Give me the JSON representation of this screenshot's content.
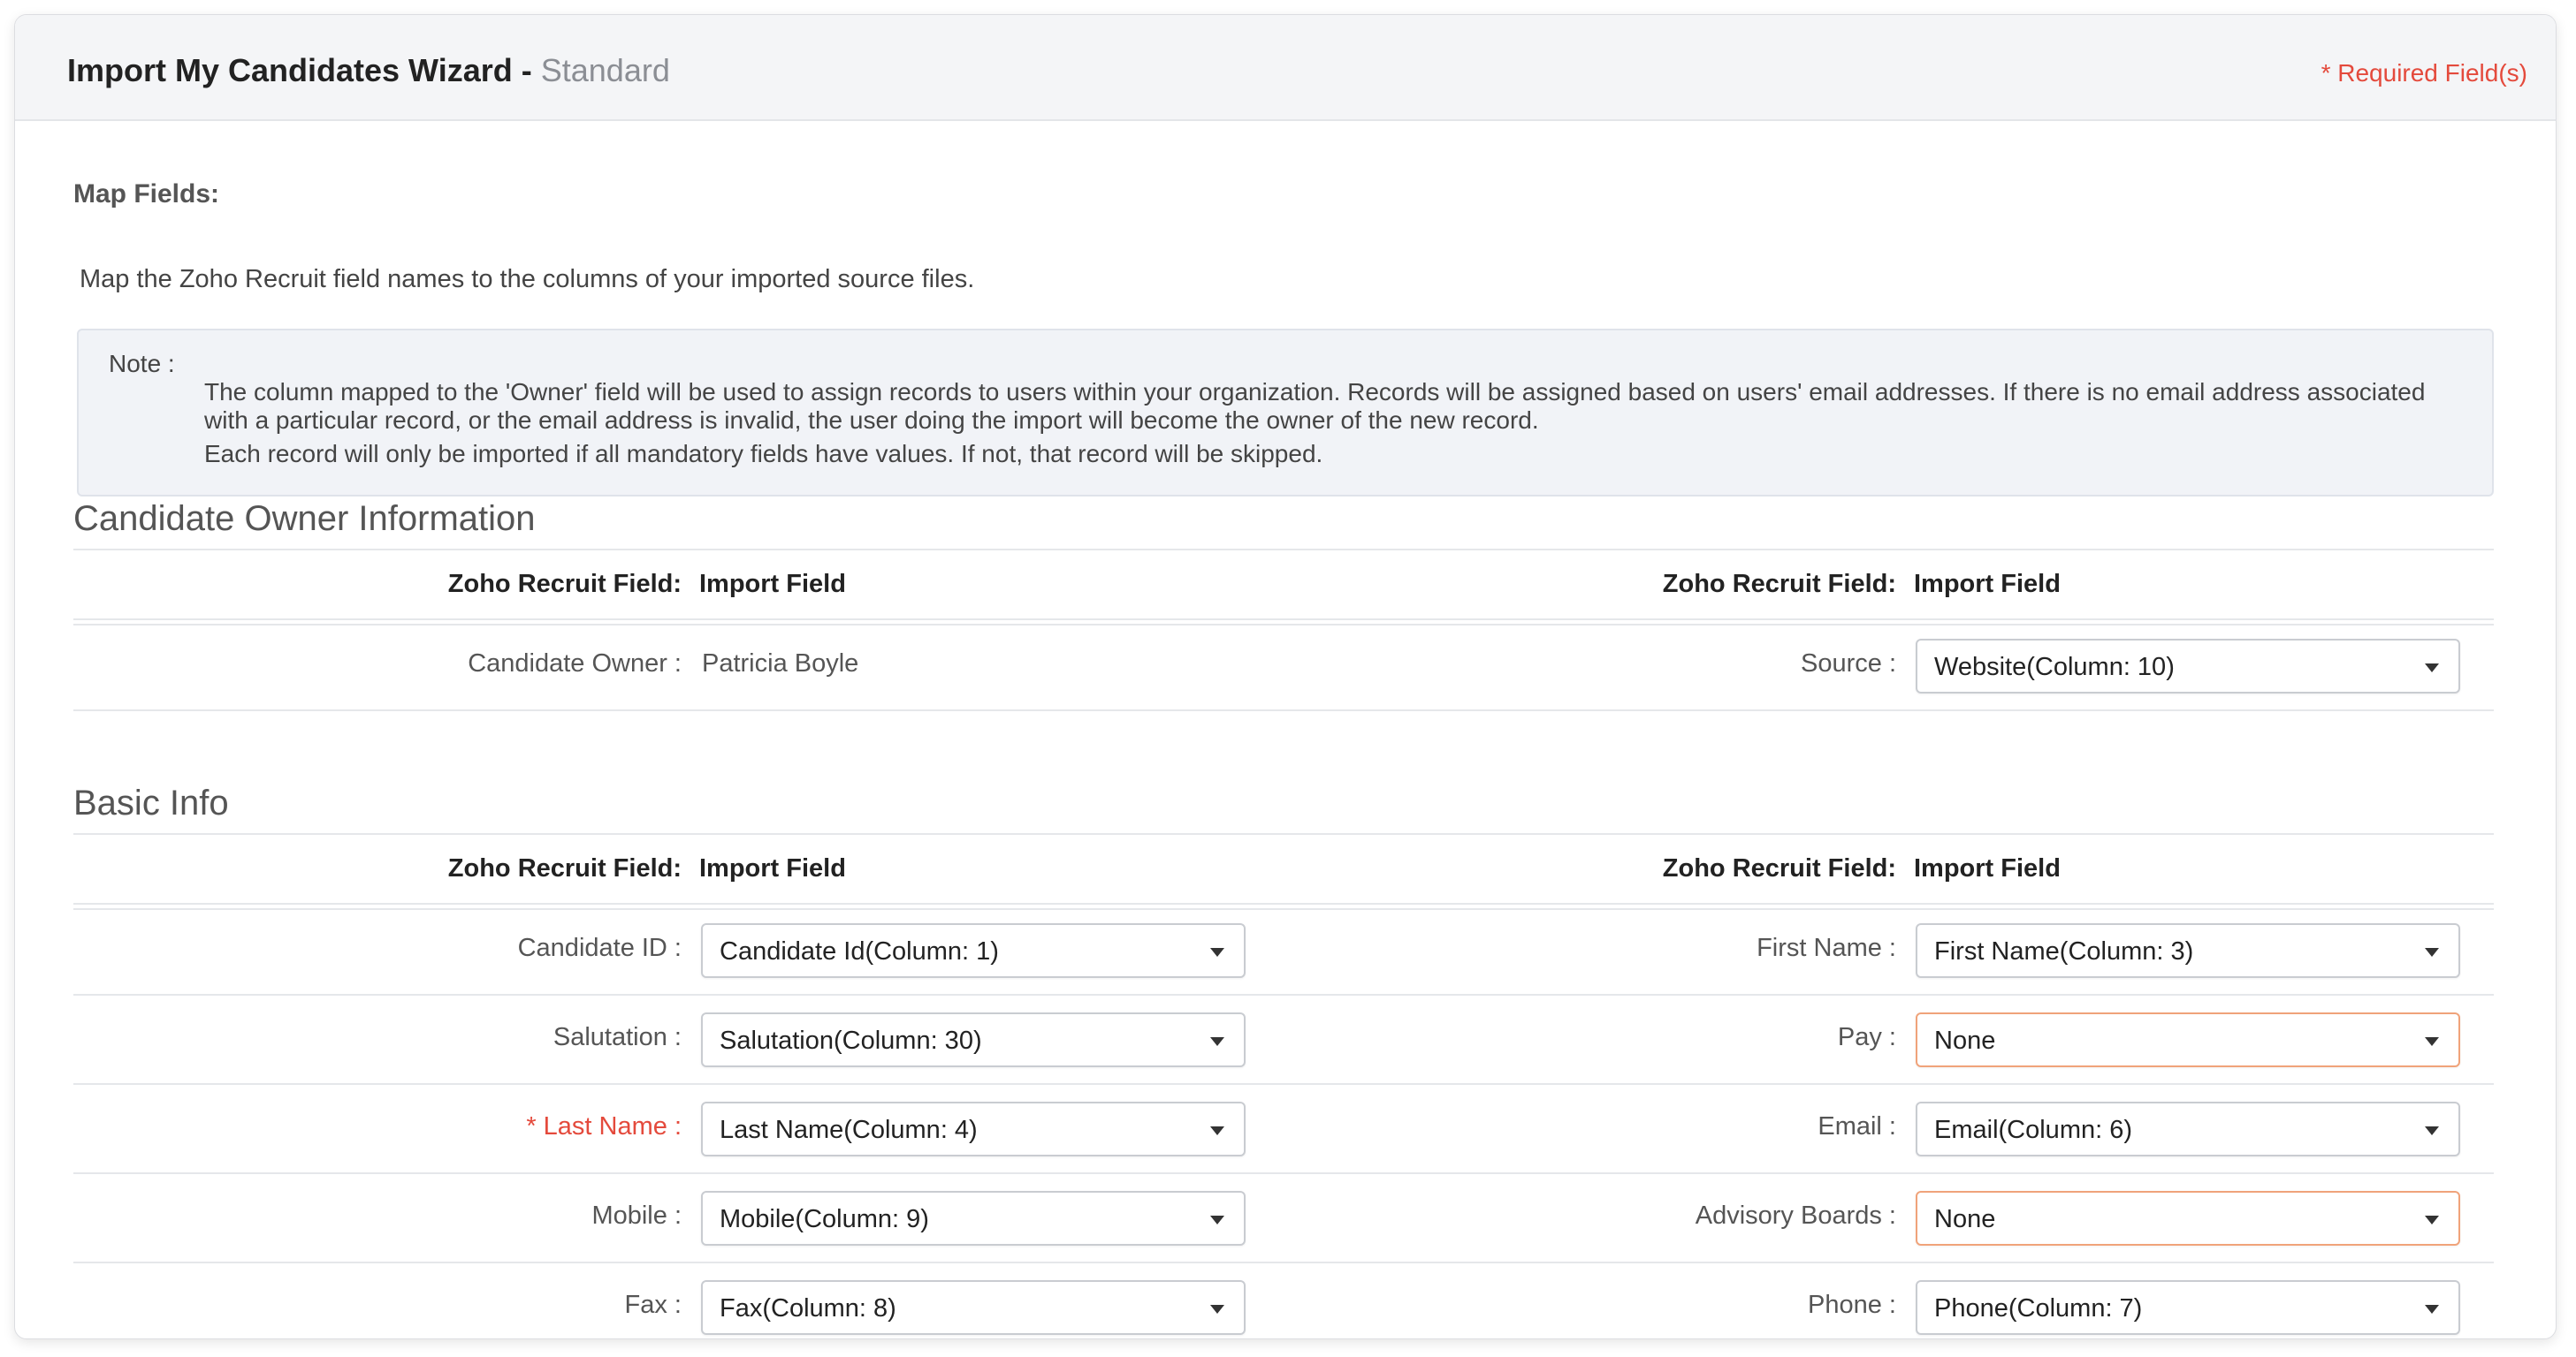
{
  "header": {
    "title": "Import My Candidates Wizard",
    "separator": " - ",
    "mode": "Standard",
    "required_note": "* Required Field(s)"
  },
  "map": {
    "label": "Map Fields:",
    "description": "Map the Zoho Recruit field names to the columns of your imported source files."
  },
  "note": {
    "title": "Note :",
    "line1": "The column mapped to the 'Owner' field will be used to assign records to users within your organization. Records will be assigned based on users' email addresses. If there is no email address associated",
    "line2": "with a particular record, or the email address is invalid, the user doing the import will become the owner of the new record.",
    "line3": "Each record will only be imported if all mandatory fields have values. If not, that record will be skipped."
  },
  "column_headers": {
    "zoho_field": "Zoho Recruit Field:",
    "import_field": "Import Field"
  },
  "owner_section": {
    "title": "Candidate Owner Information",
    "owner_label": "Candidate Owner :",
    "owner_value": "Patricia Boyle",
    "source_label": "Source :",
    "source_value": "Website(Column: 10)"
  },
  "basic_section": {
    "title": "Basic Info",
    "rows": [
      {
        "left_label": "Candidate ID :",
        "left_value": "Candidate Id(Column: 1)",
        "right_label": "First Name :",
        "right_value": "First Name(Column: 3)"
      },
      {
        "left_label": "Salutation :",
        "left_value": "Salutation(Column: 30)",
        "right_label": "Pay :",
        "right_value": "None"
      },
      {
        "left_label": "* Last Name :",
        "left_value": "Last Name(Column: 4)",
        "right_label": "Email :",
        "right_value": "Email(Column: 6)"
      },
      {
        "left_label": "Mobile :",
        "left_value": "Mobile(Column: 9)",
        "right_label": "Advisory Boards :",
        "right_value": "None"
      },
      {
        "left_label": "Fax :",
        "left_value": "Fax(Column: 8)",
        "right_label": "Phone :",
        "right_value": "Phone(Column: 7)"
      }
    ]
  },
  "colors": {
    "required": "#e44a3c",
    "unmapped_border": "#f0a37a",
    "header_bg": "#f4f5f7",
    "note_bg": "#f1f3f7"
  }
}
